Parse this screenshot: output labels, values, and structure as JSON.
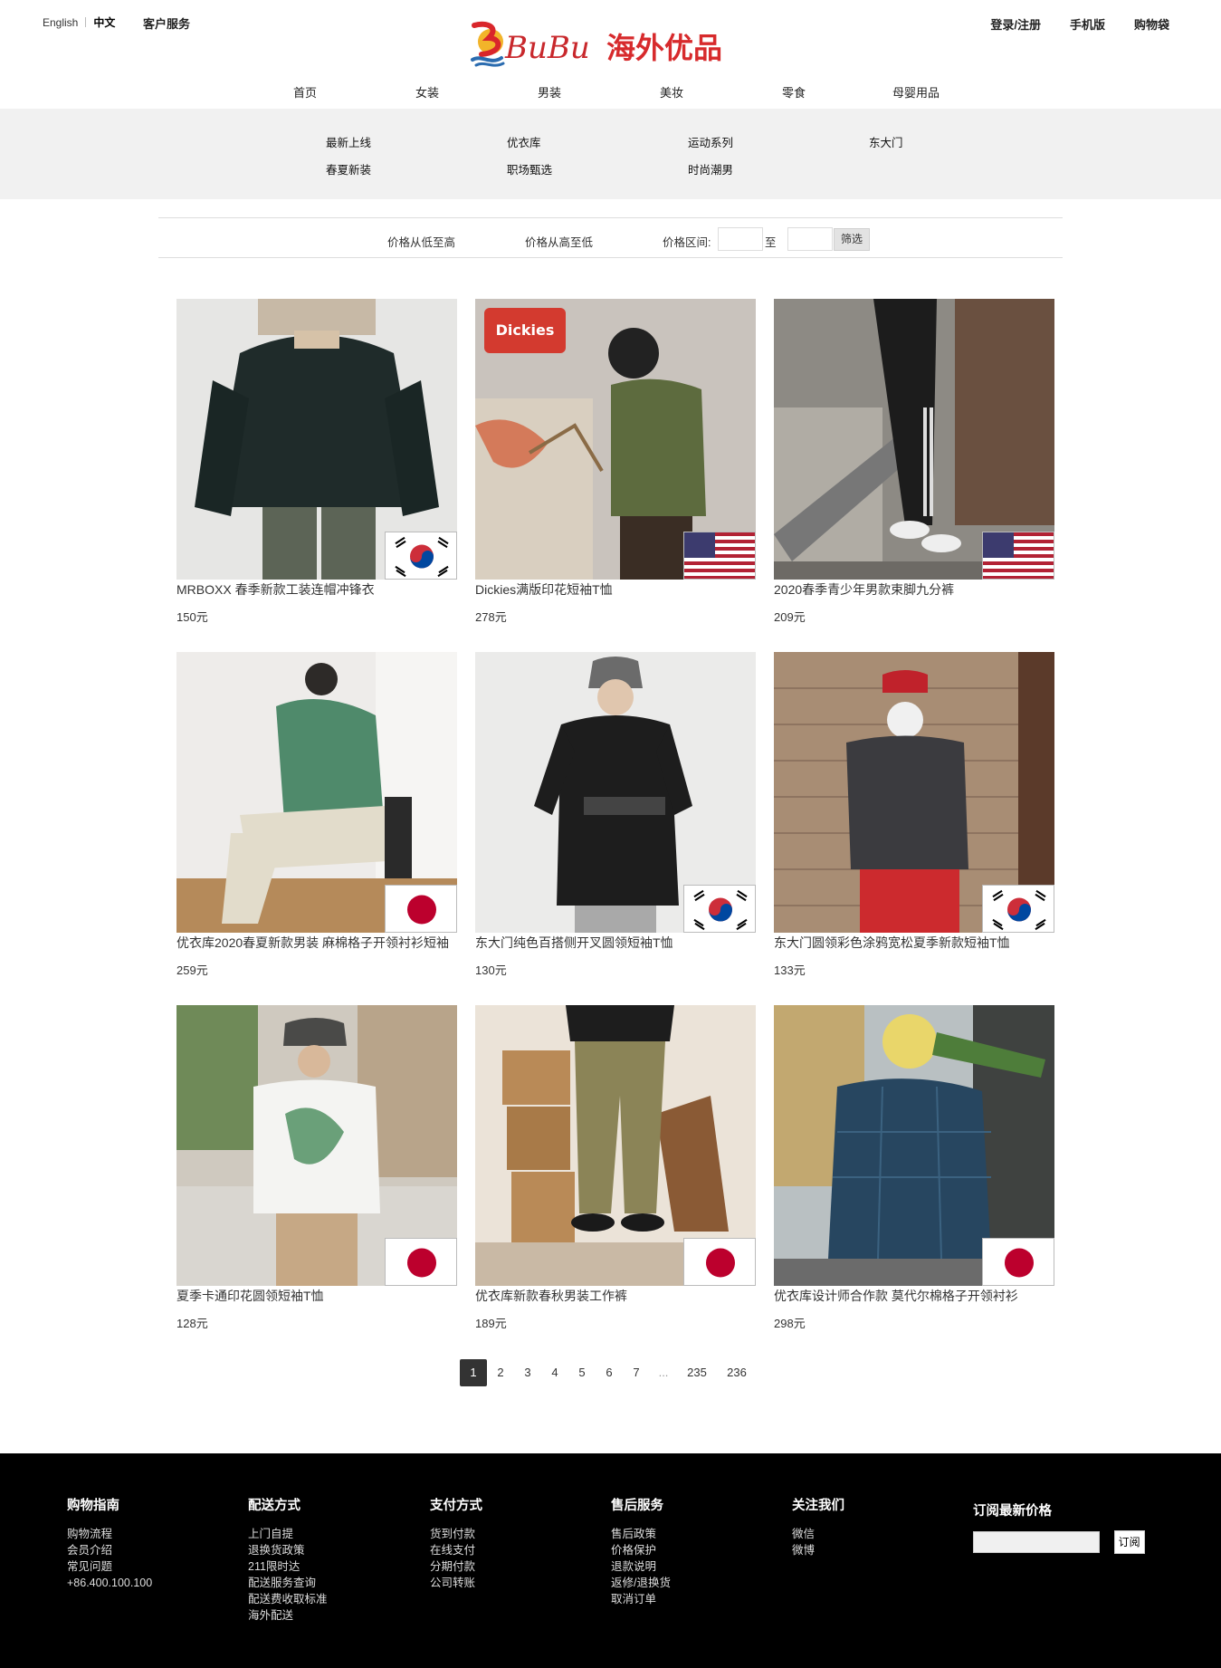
{
  "header": {
    "lang_en": "English",
    "lang_zh": "中文",
    "customer_service": "客户服务",
    "login": "登录/注册",
    "mobile": "手机版",
    "cart": "购物袋",
    "logo_text": "BuBu海外优品"
  },
  "main_nav": [
    "首页",
    "女装",
    "男装",
    "美妆",
    "零食",
    "母婴用品"
  ],
  "sub_nav": {
    "row1": [
      "最新上线",
      "优衣库",
      "运动系列",
      "东大门"
    ],
    "row2": [
      "春夏新装",
      "职场甄选",
      "时尚潮男"
    ]
  },
  "filter": {
    "low_high": "价格从低至高",
    "high_low": "价格从高至低",
    "range_label": "价格区间:",
    "to": "至",
    "min_value": "",
    "max_value": "",
    "button": "筛选"
  },
  "products": [
    {
      "name": "MRBOXX 春季新款工装连帽冲锋衣",
      "price": "150元",
      "flag": "korea"
    },
    {
      "name": "Dickies满版印花短袖T恤",
      "price": "278元",
      "flag": "usa"
    },
    {
      "name": "2020春季青少年男款束脚九分裤",
      "price": "209元",
      "flag": "usa"
    },
    {
      "name": "优衣库2020春夏新款男装 麻棉格子开领衬衫短袖",
      "price": "259元",
      "flag": "japan"
    },
    {
      "name": "东大门纯色百搭侧开叉圆领短袖T恤",
      "price": "130元",
      "flag": "korea"
    },
    {
      "name": "东大门圆领彩色涂鸦宽松夏季新款短袖T恤",
      "price": "133元",
      "flag": "korea"
    },
    {
      "name": "夏季卡通印花圆领短袖T恤",
      "price": "128元",
      "flag": "japan"
    },
    {
      "name": "优衣库新款春秋男装工作裤",
      "price": "189元",
      "flag": "japan"
    },
    {
      "name": "优衣库设计师合作款 莫代尔棉格子开领衬衫",
      "price": "298元",
      "flag": "japan"
    }
  ],
  "photo_logo_text": "Dickies",
  "pagination": [
    "1",
    "2",
    "3",
    "4",
    "5",
    "6",
    "7",
    "...",
    "235",
    "236"
  ],
  "footer": {
    "columns": [
      {
        "title": "购物指南",
        "links": [
          "购物流程",
          "会员介绍",
          "常见问题",
          "+86.400.100.100"
        ]
      },
      {
        "title": "配送方式",
        "links": [
          "上门自提",
          "退换货政策",
          "211限时达",
          "配送服务查询",
          "配送费收取标准",
          "海外配送"
        ]
      },
      {
        "title": "支付方式",
        "links": [
          "货到付款",
          "在线支付",
          "分期付款",
          "公司转账"
        ]
      },
      {
        "title": "售后服务",
        "links": [
          "售后政策",
          "价格保护",
          "退款说明",
          "返修/退换货",
          "取消订单"
        ]
      },
      {
        "title": "关注我们",
        "links": [
          "微信",
          "微博"
        ]
      }
    ],
    "subscribe_title": "订阅最新价格",
    "subscribe_button": "订阅"
  }
}
